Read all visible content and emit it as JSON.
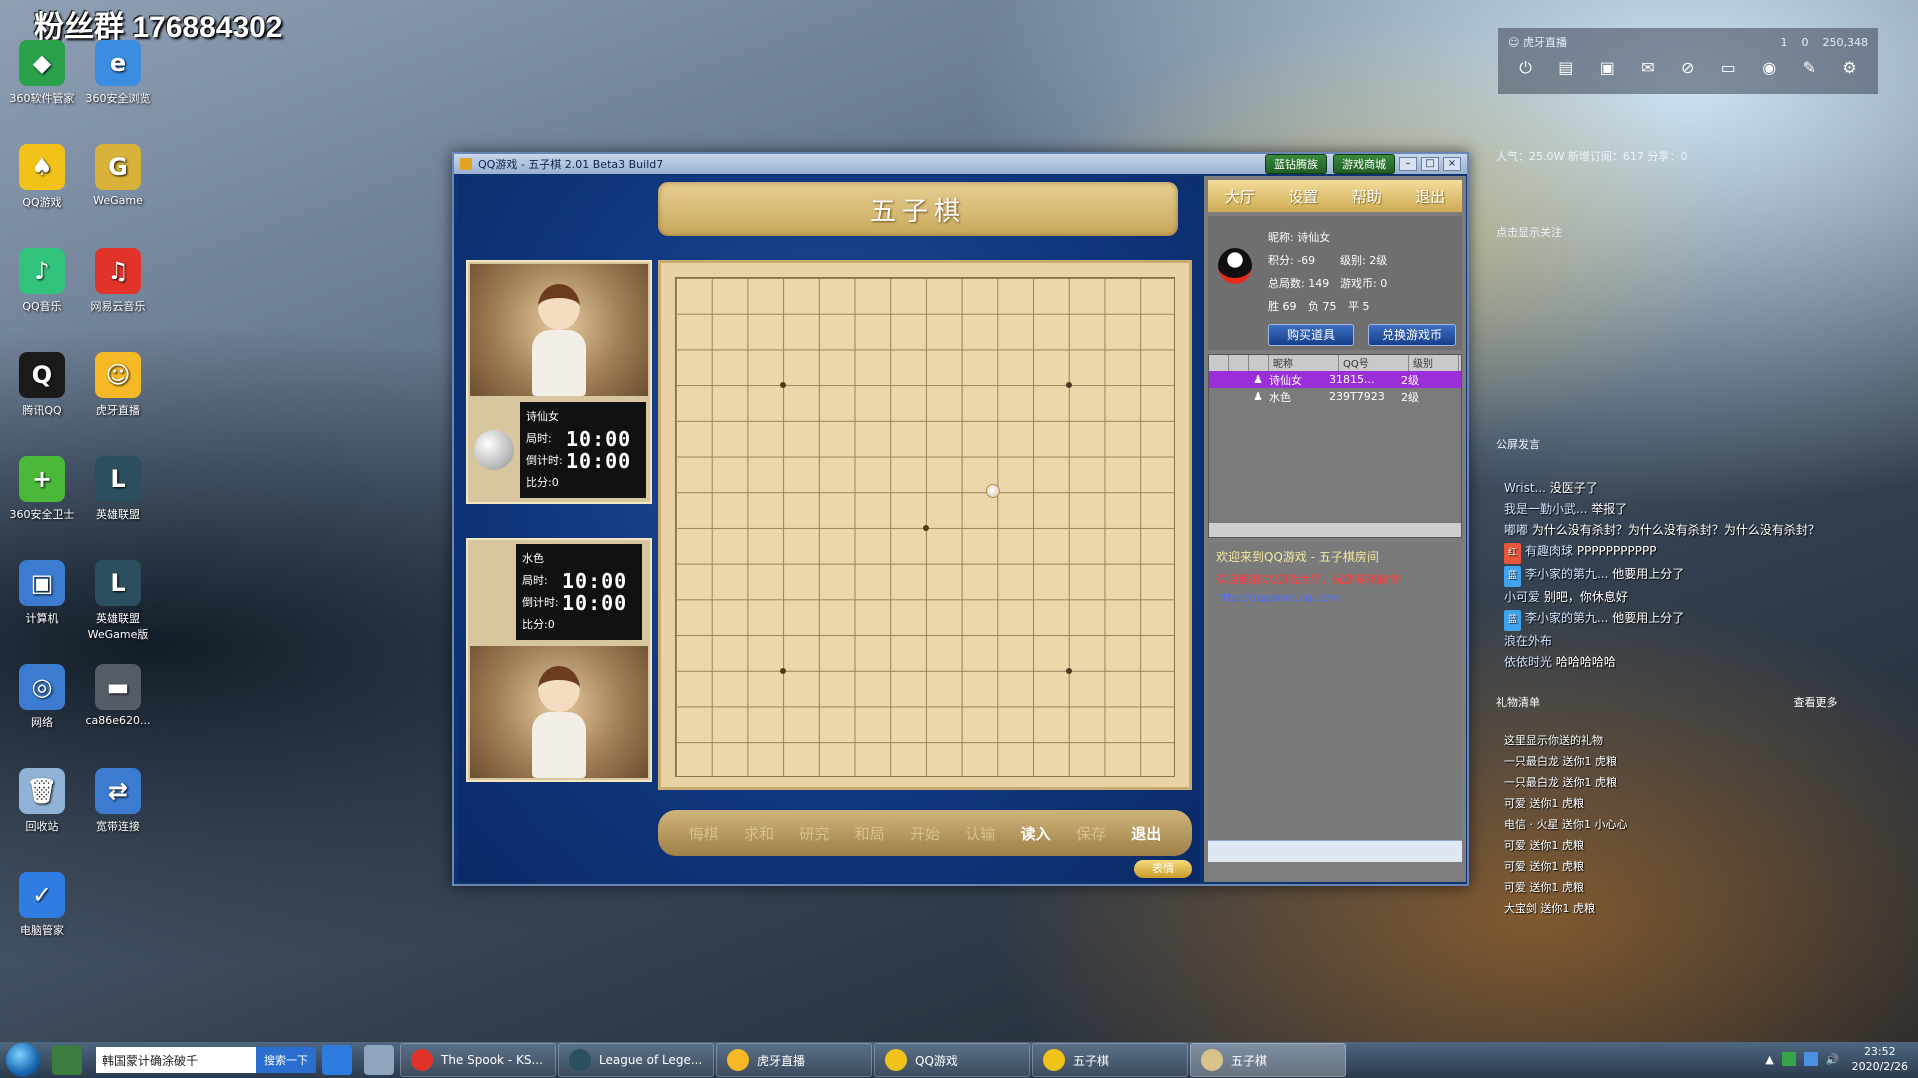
{
  "desktop": {
    "fan_banner": "粉丝群 176884302",
    "icons": [
      {
        "label": "360软件管家",
        "color": "#2aa04a",
        "glyph": "◆"
      },
      {
        "label": "360安全浏览",
        "color": "#3a8de0",
        "glyph": "e"
      },
      {
        "label": "QQ游戏",
        "color": "#f0c21a",
        "glyph": "♠"
      },
      {
        "label": "WeGame",
        "color": "#d9b23a",
        "glyph": "G"
      },
      {
        "label": "QQ音乐",
        "color": "#31c27c",
        "glyph": "♪"
      },
      {
        "label": "网易云音乐",
        "color": "#e2332a",
        "glyph": "♫"
      },
      {
        "label": "腾讯QQ",
        "color": "#1a1a1a",
        "glyph": "Q"
      },
      {
        "label": "虎牙直播",
        "color": "#f6b825",
        "glyph": "☺"
      },
      {
        "label": "360安全卫士",
        "color": "#4cb83a",
        "glyph": "+"
      },
      {
        "label": "英雄联盟",
        "color": "#2b4f5e",
        "glyph": "L"
      },
      {
        "label": "计算机",
        "color": "#3b7bd0",
        "glyph": "▣"
      },
      {
        "label": "英雄联盟WeGame版",
        "color": "#2b4f5e",
        "glyph": "L"
      },
      {
        "label": "网络",
        "color": "#3b7bd0",
        "glyph": "◎"
      },
      {
        "label": "ca86e620...",
        "color": "#555c66",
        "glyph": "▬"
      },
      {
        "label": "回收站",
        "color": "#8fb2d6",
        "glyph": "🗑"
      },
      {
        "label": "宽带连接",
        "color": "#3b7bd0",
        "glyph": "⇄"
      },
      {
        "label": "电脑管家",
        "color": "#2f7de3",
        "glyph": "✓"
      }
    ]
  },
  "game_window": {
    "title": "QQ游戏 - 五子棋  2.01 Beta3 Build7",
    "top_buttons": [
      "蓝钻腾族",
      "游戏商城"
    ],
    "board_title": "五子棋",
    "player1": {
      "name": "诗仙女",
      "bushi_label": "局时:",
      "bushi": "10:00",
      "daojishi_label": "倒计时:",
      "daojishi": "10:00",
      "score": "比分:0"
    },
    "player2": {
      "name": "水色",
      "bushi_label": "局时:",
      "bushi": "10:00",
      "daojishi_label": "倒计时:",
      "daojishi": "10:00",
      "score": "比分:0"
    },
    "bottom_buttons": [
      "悔棋",
      "求和",
      "研究",
      "和局",
      "开始",
      "认输",
      "读入",
      "保存",
      "退出"
    ],
    "emote_button": "表情",
    "menu": [
      "大厅",
      "设置",
      "帮助",
      "退出"
    ],
    "profile": {
      "nickname": "昵称: 诗仙女",
      "jifen": "积分: -69",
      "jibie": "级别: 2级",
      "zongjushu": "总局数: 149",
      "youxibi": "游戏币: 0",
      "sheng": "胜 69",
      "fu": "负 75",
      "ping": "平 5",
      "buy_button": "购买道具",
      "exchange_button": "兑换游戏币"
    },
    "user_list": {
      "headers": [
        "",
        "",
        "",
        "昵称",
        "QQ号",
        "级别"
      ],
      "rows": [
        {
          "name": "诗仙女",
          "qq": "31815...",
          "level": "2级",
          "selected": true
        },
        {
          "name": "水色",
          "qq": "239T7923",
          "level": "2级",
          "selected": false
        }
      ]
    },
    "chat": {
      "welcome": "欢迎来到QQ游戏 - 五子棋房间",
      "notice_red": "欢迎使用QQ游戏大厅，祝您游戏愉快！",
      "notice_blue": "http://qqgame.qq.com"
    }
  },
  "stream": {
    "title": "虎牙直播",
    "stats_top": [
      "1",
      "0",
      "250,348"
    ],
    "stats_line": "人气：25.0W  新增订阅：617  分享：0",
    "tip": "点击显示关注",
    "section_title": "公屏发言",
    "danmaku": [
      {
        "tag": "",
        "user": "Wrist...",
        "text": "没医子了"
      },
      {
        "tag": "",
        "user": "我是一勤小武...",
        "text": "举报了"
      },
      {
        "tag": "",
        "user": "嘟嘟",
        "text": "为什么没有杀封？为什么没有杀封？为什么没有杀封？"
      },
      {
        "tag": "红",
        "user": "有趣肉球",
        "text": "PPPPPPPPPPP"
      },
      {
        "tag": "蓝",
        "user": "李小家的第九...",
        "text": "他要用上分了"
      },
      {
        "tag": "",
        "user": "小可爱",
        "text": "别吧，你休息好"
      },
      {
        "tag": "蓝",
        "user": "李小家的第九...",
        "text": "他要用上分了"
      },
      {
        "tag": "",
        "user": "浪在外布",
        "text": ""
      },
      {
        "tag": "",
        "user": "依依时光",
        "text": "哈哈哈哈哈"
      }
    ],
    "gift_title": "礼物清单",
    "gift_more": "查看更多",
    "gifts": [
      "这里显示你送的礼物",
      "一只最白龙 送你1 虎粮",
      "一只最白龙 送你1 虎粮",
      "可爱 送你1 虎粮",
      "电信 · 火星 送你1 小心心",
      "可爱 送你1 虎粮",
      "可爱 送你1 虎粮",
      "可爱 送你1 虎粮",
      "大宝剑 送你1 虎粮"
    ]
  },
  "taskbar": {
    "search_text": "韩国蒙计确涂破千",
    "search_button": "搜索一下",
    "tasks": [
      {
        "label": "The Spook - KS...",
        "color": "#e2332a"
      },
      {
        "label": "League of Lege...",
        "color": "#2b4f5e"
      },
      {
        "label": "虎牙直播",
        "color": "#f6b825"
      },
      {
        "label": "QQ游戏",
        "color": "#f0c21a"
      },
      {
        "label": "五子棋",
        "color": "#f0c21a"
      },
      {
        "label": "五子棋",
        "color": "#d9c38a"
      }
    ],
    "time": "23:52",
    "date": "2020/2/26"
  }
}
